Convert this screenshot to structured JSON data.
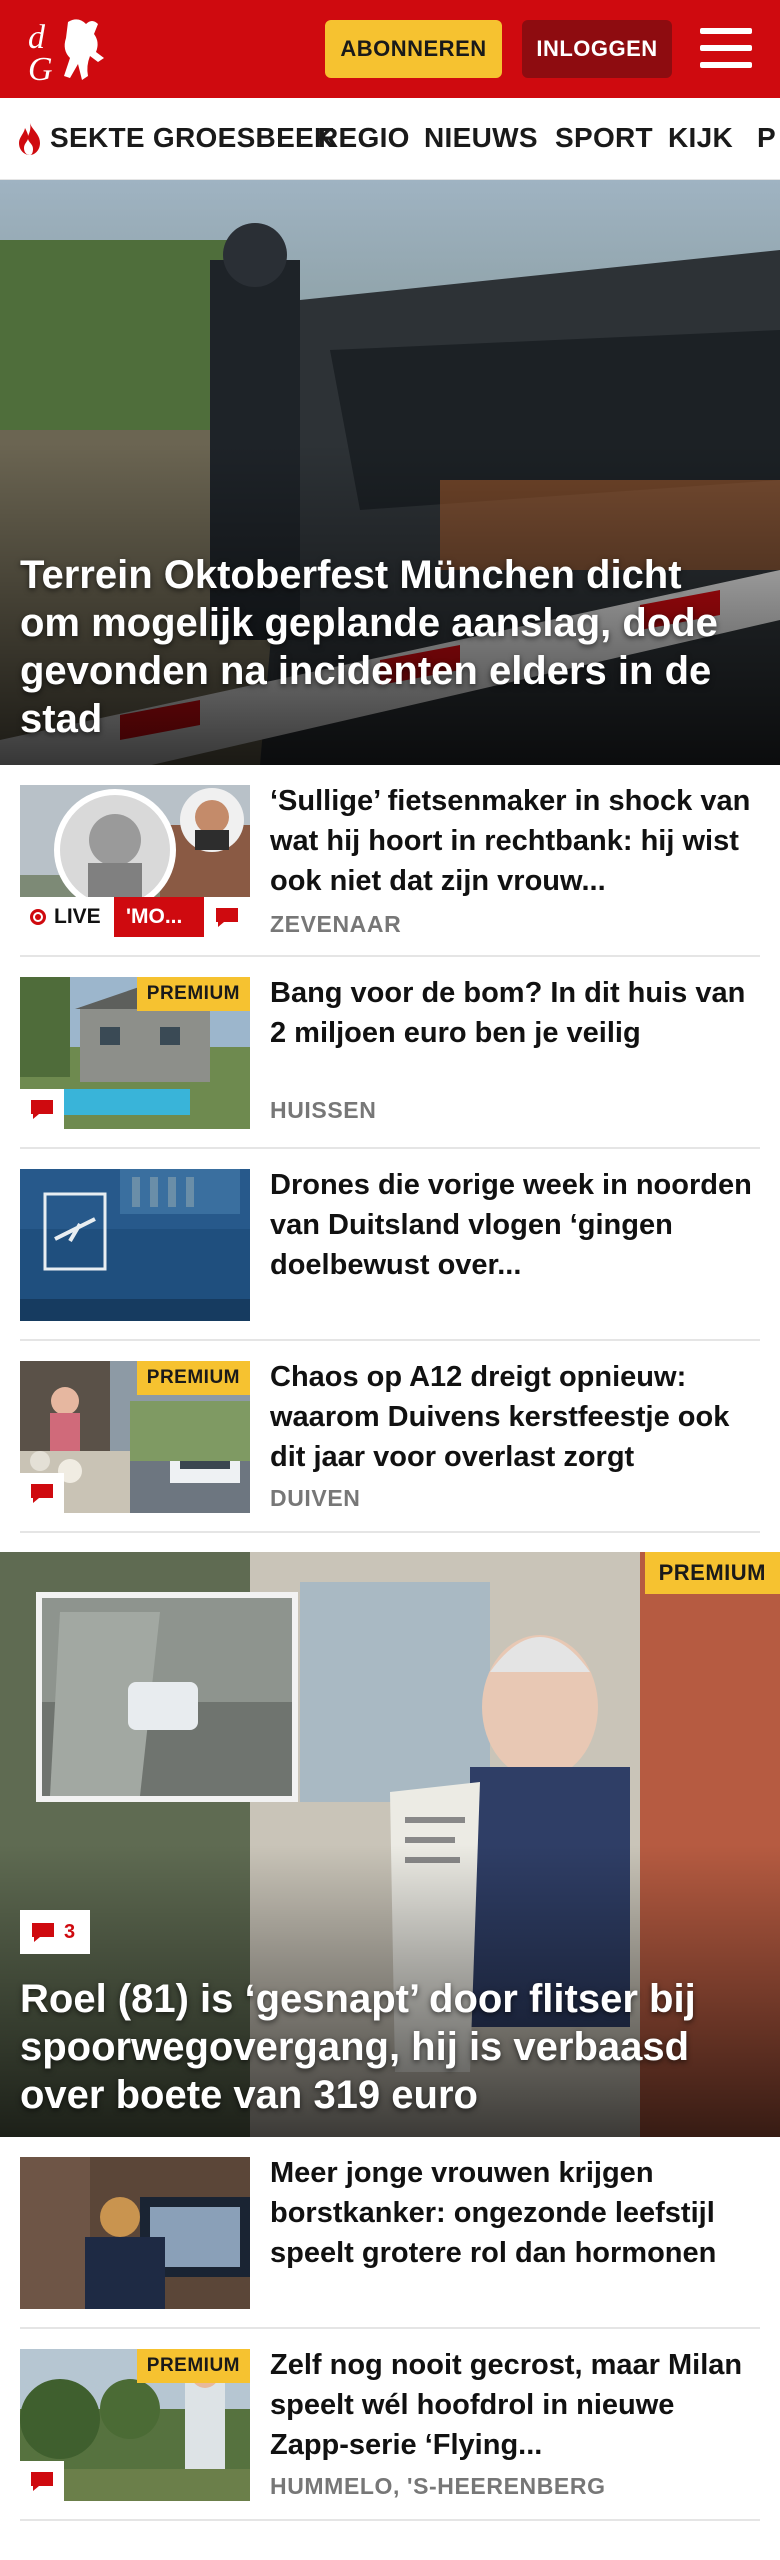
{
  "header": {
    "logo_text": "dG",
    "subscribe_label": "ABONNEREN",
    "login_label": "INLOGGEN",
    "brand_color": "#cf0a0f"
  },
  "nav": {
    "items": [
      {
        "label": "SEKTE GROESBEEK",
        "icon": "flame-icon"
      },
      {
        "label": "REGIO"
      },
      {
        "label": "NIEUWS"
      },
      {
        "label": "SPORT"
      },
      {
        "label": "KIJK"
      },
      {
        "label": "P"
      }
    ]
  },
  "hero": {
    "title": "Terrein Oktoberfest München dicht om mogelijk geplande aanslag, dode gevonden na incidenten elders in de stad"
  },
  "articles": [
    {
      "title": "‘Sullige’ fietsenmaker in shock van wat hij hoort in rechtbank: hij wist ook niet dat zijn vrouw...",
      "location": "ZEVENAAR",
      "live": "LIVE",
      "live_tag": "'MO..."
    },
    {
      "title": "Bang voor de bom? In dit huis van 2 miljoen euro ben je veilig",
      "location": "HUISSEN",
      "premium": "PREMIUM"
    },
    {
      "title": "Drones die vorige week in noorden van Duitsland vlogen ‘gingen doelbewust over...",
      "location": ""
    },
    {
      "title": "Chaos op A12 dreigt opnieuw: waarom Duivens kerstfeestje ook dit jaar voor overlast zorgt",
      "location": "DUIVEN",
      "premium": "PREMIUM"
    }
  ],
  "feature": {
    "premium": "PREMIUM",
    "comments": "3",
    "title": "Roel (81) is ‘gesnapt’ door flitser bij spoorwegovergang, hij is verbaasd over boete van 319 euro"
  },
  "articles2": [
    {
      "title": "Meer jonge vrouwen krijgen borstkanker: ongezonde leefstijl speelt grotere rol dan hormonen",
      "location": ""
    },
    {
      "title": "Zelf nog nooit gecrost, maar Milan speelt wél hoofdrol in nieuwe Zapp-serie ‘Flying...",
      "location": "HUMMELO, 'S-HEERENBERG",
      "premium": "PREMIUM"
    }
  ]
}
